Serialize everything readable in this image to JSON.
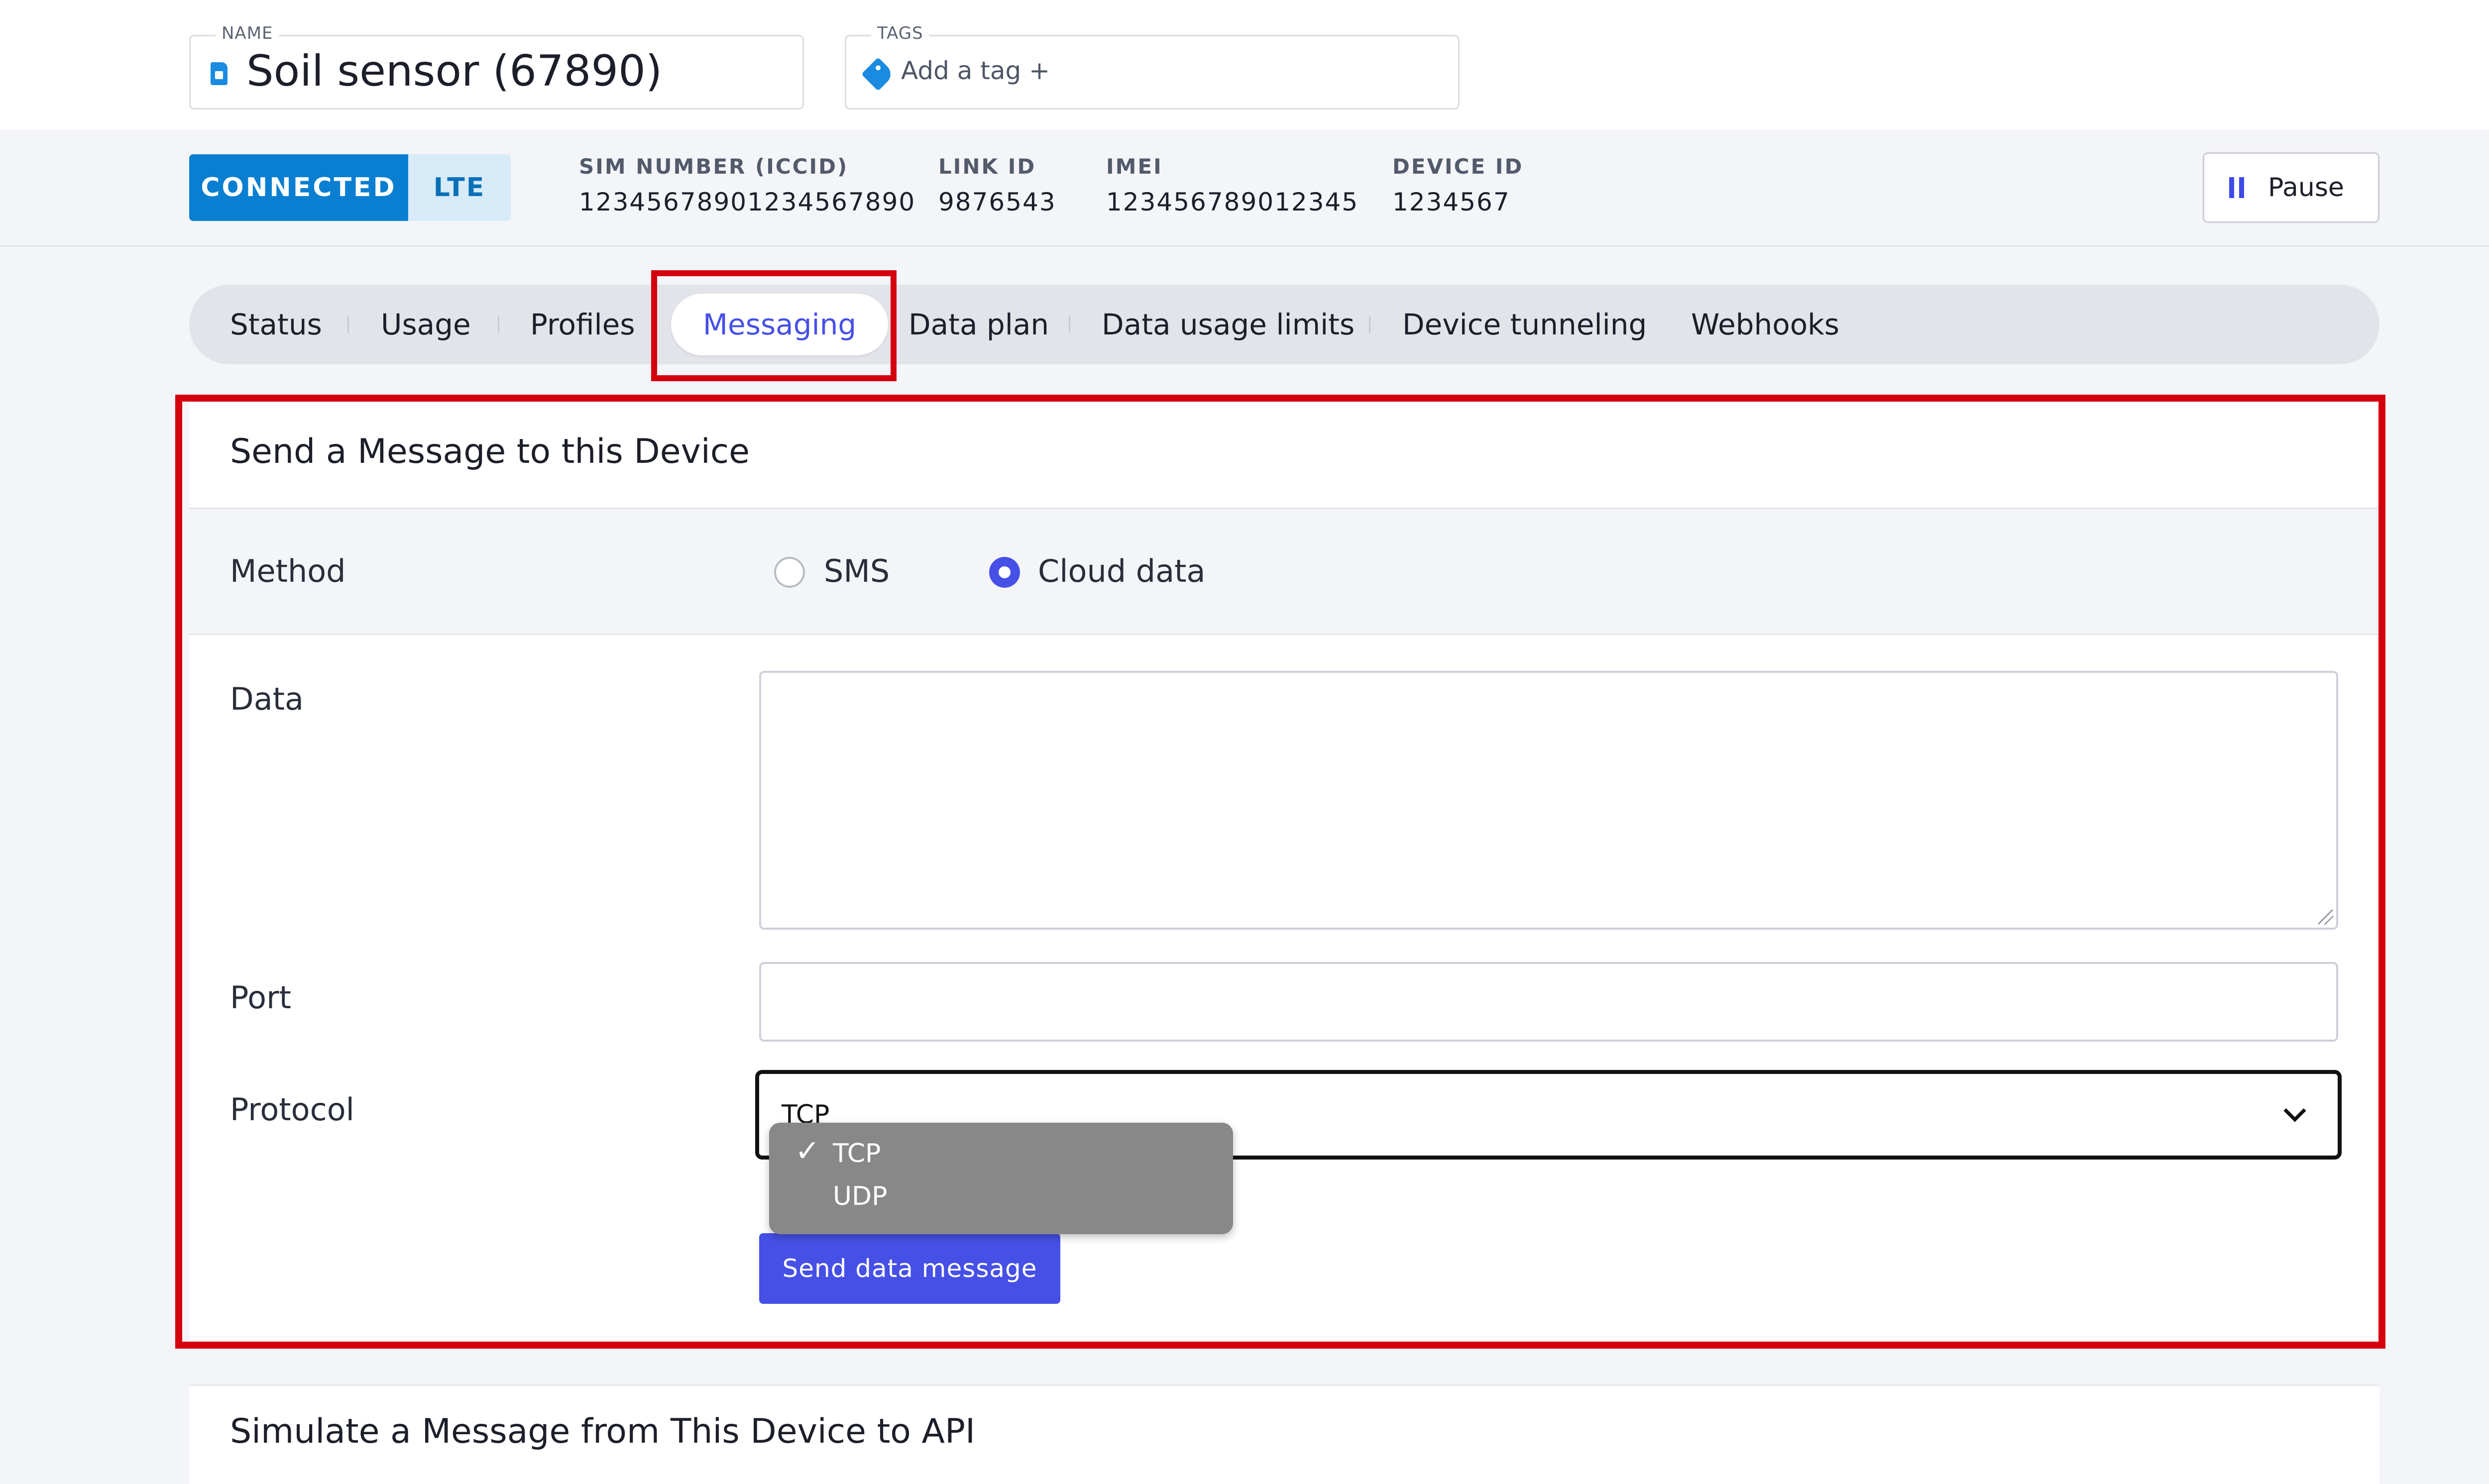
{
  "header": {
    "name_label": "NAME",
    "name_value": "Soil sensor (67890)",
    "tags_label": "TAGS",
    "tags_placeholder": "Add a tag +"
  },
  "status": {
    "connection": "CONNECTED",
    "network": "LTE",
    "sim_label": "SIM NUMBER (ICCID)",
    "sim_value": "12345678901234567890",
    "link_label": "LINK ID",
    "link_value": "9876543",
    "imei_label": "IMEI",
    "imei_value": "123456789012345",
    "device_label": "DEVICE ID",
    "device_value": "1234567",
    "pause_label": "Pause"
  },
  "tabs": [
    "Status",
    "Usage",
    "Profiles",
    "Messaging",
    "Data plan",
    "Data usage limits",
    "Device tunneling",
    "Webhooks"
  ],
  "active_tab": "Messaging",
  "panel": {
    "title": "Send a Message to this Device",
    "method_label": "Method",
    "method_options": [
      "SMS",
      "Cloud data"
    ],
    "method_selected": "Cloud data",
    "data_label": "Data",
    "data_value": "",
    "port_label": "Port",
    "port_value": "",
    "protocol_label": "Protocol",
    "protocol_value": "TCP",
    "protocol_options": [
      "TCP",
      "UDP"
    ],
    "send_label": "Send data message"
  },
  "next_section_title": "Simulate a Message from This Device to API",
  "colors": {
    "accent": "#4650e6",
    "connected": "#0a7fd1",
    "highlight": "#d4000f"
  }
}
